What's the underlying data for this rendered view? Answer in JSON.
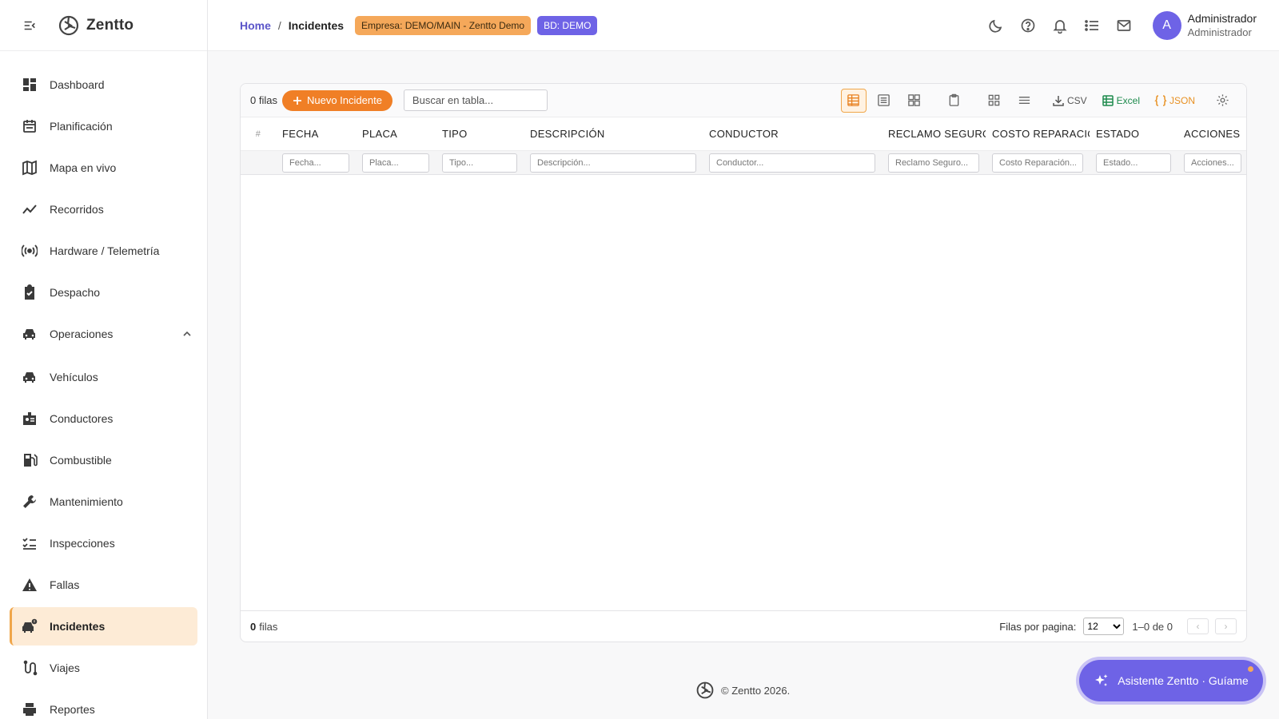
{
  "app": {
    "name": "Zentto"
  },
  "sidebar": {
    "items": [
      {
        "label": "Dashboard",
        "icon": "dashboard-icon"
      },
      {
        "label": "Planificación",
        "icon": "calendar-icon"
      },
      {
        "label": "Mapa en vivo",
        "icon": "map-icon"
      },
      {
        "label": "Recorridos",
        "icon": "trend-line-icon"
      },
      {
        "label": "Hardware / Telemetría",
        "icon": "signal-icon"
      },
      {
        "label": "Despacho",
        "icon": "clipboard-check-icon"
      },
      {
        "label": "Operaciones",
        "icon": "car-icon"
      },
      {
        "label": "Vehículos",
        "icon": "car-icon"
      },
      {
        "label": "Conductores",
        "icon": "badge-icon"
      },
      {
        "label": "Combustible",
        "icon": "fuel-icon"
      },
      {
        "label": "Mantenimiento",
        "icon": "wrench-icon"
      },
      {
        "label": "Inspecciones",
        "icon": "checklist-icon"
      },
      {
        "label": "Fallas",
        "icon": "warning-icon"
      },
      {
        "label": "Incidentes",
        "icon": "incident-icon"
      },
      {
        "label": "Viajes",
        "icon": "route-icon"
      },
      {
        "label": "Reportes",
        "icon": "print-icon"
      }
    ],
    "active": "Incidentes"
  },
  "breadcrumb": {
    "home": "Home",
    "sep": "/",
    "current": "Incidentes"
  },
  "badges": {
    "company": "Empresa: DEMO/MAIN - Zentto Demo",
    "db": "BD: DEMO"
  },
  "user": {
    "initial": "A",
    "name": "Administrador",
    "role": "Administrador"
  },
  "toolbar": {
    "row_count": "0 filas",
    "new_label": "Nuevo Incidente",
    "search_placeholder": "Buscar en tabla...",
    "csv": "CSV",
    "excel": "Excel",
    "json": "JSON"
  },
  "columns": [
    {
      "header": "#",
      "filter": ""
    },
    {
      "header": "FECHA",
      "filter": "Fecha..."
    },
    {
      "header": "PLACA",
      "filter": "Placa..."
    },
    {
      "header": "TIPO",
      "filter": "Tipo..."
    },
    {
      "header": "DESCRIPCIÓN",
      "filter": "Descripción..."
    },
    {
      "header": "CONDUCTOR",
      "filter": "Conductor..."
    },
    {
      "header": "RECLAMO SEGURO",
      "filter": "Reclamo Seguro..."
    },
    {
      "header": "COSTO REPARACIÓ",
      "filter": "Costo Reparación..."
    },
    {
      "header": "ESTADO",
      "filter": "Estado..."
    },
    {
      "header": "ACCIONES",
      "filter": "Acciones..."
    }
  ],
  "footer": {
    "count": "0",
    "count_label": "filas",
    "rows_per_page_label": "Filas por pagina:",
    "rows_per_page": "12",
    "range": "1–0 de 0",
    "prev": "‹",
    "next": "›"
  },
  "page_footer": "© Zentto 2026.",
  "assistant": {
    "label": "Asistente Zentto · Guíame"
  },
  "colors": {
    "accent": "#f07f26",
    "brand": "#6e63e6",
    "active_bg": "#fdebd6"
  }
}
